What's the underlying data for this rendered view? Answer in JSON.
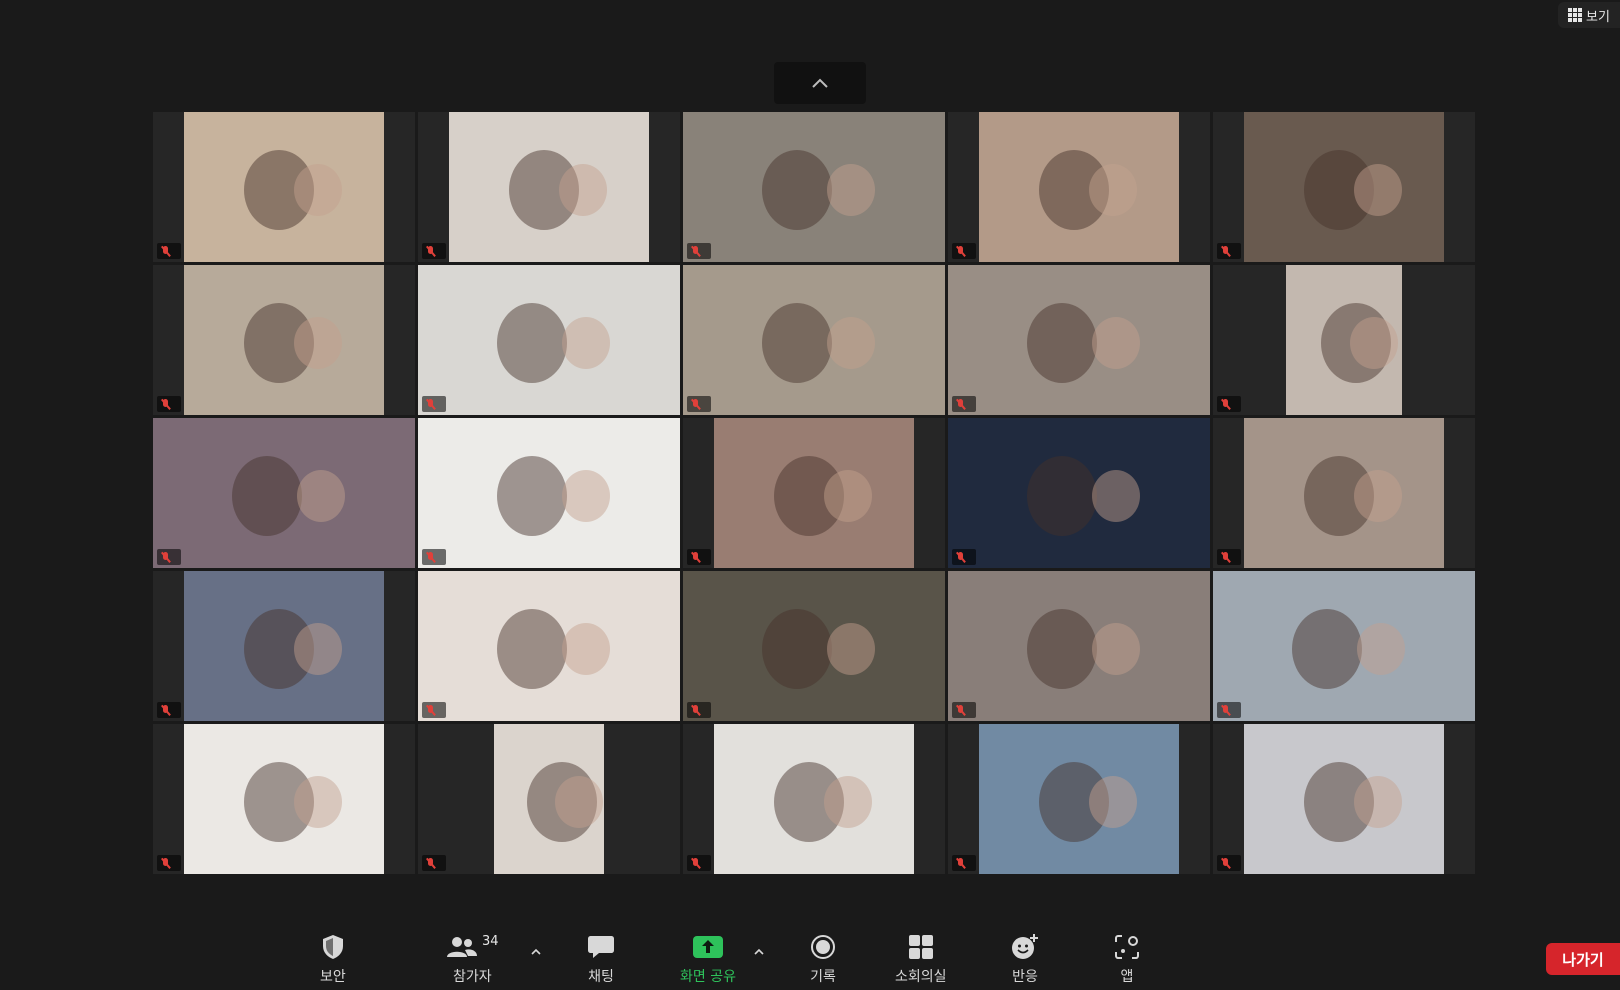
{
  "top": {
    "view_label": "보기"
  },
  "gallery": {
    "tiles": [
      {
        "name": "",
        "video_color": "#c9b39a",
        "video_width": 200
      },
      {
        "name": "",
        "video_color": "#d8d0c8",
        "video_width": 200
      },
      {
        "name": "",
        "video_color": "#8a8278",
        "video_width": 262
      },
      {
        "name": "",
        "video_color": "#b59a86",
        "video_width": 200
      },
      {
        "name": "",
        "video_color": "#6a5a4e",
        "video_width": 200
      },
      {
        "name": "",
        "video_color": "#b8aa98",
        "video_width": 200
      },
      {
        "name": "",
        "video_color": "#d9d7d2",
        "video_width": 262
      },
      {
        "name": "",
        "video_color": "#a69a8a",
        "video_width": 262
      },
      {
        "name": "",
        "video_color": "#9a8e84",
        "video_width": 262
      },
      {
        "name": "",
        "video_color": "#c4b8ae",
        "video_width": 116
      },
      {
        "name": "",
        "video_color": "#7d6a76",
        "video_width": 262
      },
      {
        "name": "",
        "video_color": "#ecebe8",
        "video_width": 262
      },
      {
        "name": "",
        "video_color": "#9c7c70",
        "video_width": 200
      },
      {
        "name": "",
        "video_color": "#1f2a40",
        "video_width": 262
      },
      {
        "name": "",
        "video_color": "#a69488",
        "video_width": 200
      },
      {
        "name": "",
        "video_color": "#667088",
        "video_width": 200
      },
      {
        "name": "",
        "video_color": "#e6ddd6",
        "video_width": 262
      },
      {
        "name": "",
        "video_color": "#5a5448",
        "video_width": 262
      },
      {
        "name": "",
        "video_color": "#8a7e78",
        "video_width": 262
      },
      {
        "name": "",
        "video_color": "#9ea8b2",
        "video_width": 262
      },
      {
        "name": "",
        "video_color": "#ebe8e4",
        "video_width": 200
      },
      {
        "name": "",
        "video_color": "#dcd4cc",
        "video_width": 110
      },
      {
        "name": "",
        "video_color": "#e2e0dc",
        "video_width": 200
      },
      {
        "name": "",
        "video_color": "#6f8aa6",
        "video_width": 200
      },
      {
        "name": "",
        "video_color": "#c8c8cc",
        "video_width": 200
      }
    ]
  },
  "toolbar": {
    "security": "보안",
    "participants": "참가자",
    "participants_count": "34",
    "chat": "채팅",
    "share": "화면 공유",
    "record": "기록",
    "breakout": "소회의실",
    "reactions": "반응",
    "apps": "앱",
    "leave": "나가기"
  },
  "colors": {
    "share_green": "#2ec25b",
    "leave_red": "#d6252b",
    "mute_red": "#e0403a"
  }
}
